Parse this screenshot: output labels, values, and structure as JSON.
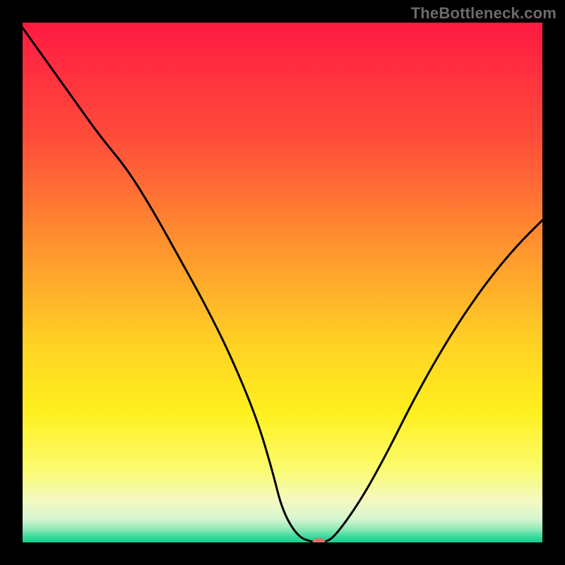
{
  "watermark": "TheBottleneck.com",
  "chart_data": {
    "type": "line",
    "title": "",
    "xlabel": "",
    "ylabel": "",
    "xlim": [
      0,
      100
    ],
    "ylim": [
      0,
      100
    ],
    "grid": false,
    "legend": false,
    "series": [
      {
        "name": "curve",
        "x": [
          0,
          5,
          10,
          15,
          20,
          25,
          30,
          35,
          40,
          45,
          48,
          50,
          53,
          56,
          58,
          60,
          65,
          70,
          75,
          80,
          85,
          90,
          95,
          100
        ],
        "values": [
          99,
          92,
          85,
          78,
          72,
          64,
          55,
          46,
          36,
          24,
          14,
          6,
          1,
          0,
          0,
          1,
          8,
          17,
          27,
          36,
          44,
          51,
          57,
          62
        ]
      }
    ],
    "marker": {
      "x": 57,
      "y": 0,
      "color": "#d5756e"
    },
    "background_gradient": {
      "stops": [
        {
          "offset": 0.0,
          "color": "#ff1a42"
        },
        {
          "offset": 0.22,
          "color": "#ff4c3a"
        },
        {
          "offset": 0.45,
          "color": "#ff9a2e"
        },
        {
          "offset": 0.62,
          "color": "#ffd224"
        },
        {
          "offset": 0.75,
          "color": "#fff01e"
        },
        {
          "offset": 0.86,
          "color": "#fbfb6f"
        },
        {
          "offset": 0.92,
          "color": "#f3f9c2"
        },
        {
          "offset": 0.955,
          "color": "#d6f6cf"
        },
        {
          "offset": 0.975,
          "color": "#8de9b7"
        },
        {
          "offset": 0.99,
          "color": "#35d89a"
        },
        {
          "offset": 1.0,
          "color": "#14cf8c"
        }
      ]
    }
  }
}
